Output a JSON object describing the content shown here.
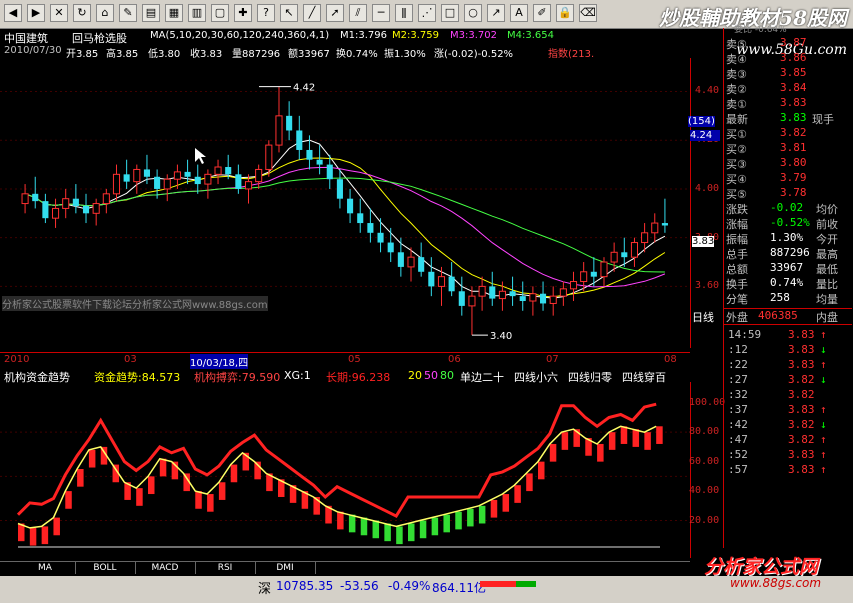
{
  "toolbar": {
    "brand": "炒股輔助教材58股网",
    "icons": [
      "back-icon",
      "forward-icon",
      "stop-icon",
      "refresh-icon",
      "home-icon",
      "edit-icon",
      "book-icon",
      "grid-icon",
      "layout-icon",
      "window-icon",
      "chart-icon",
      "help-icon",
      "cursor-icon",
      "line-icon",
      "ray-icon",
      "channel-icon",
      "hline-icon",
      "fib-icon",
      "gann-icon",
      "rect-icon",
      "ellipse-icon",
      "arrow-icon",
      "text-icon",
      "pen-icon",
      "lock-icon",
      "delete-icon"
    ]
  },
  "watermark_url": "www.58Gu.com",
  "header": {
    "stock_name": "中国建筑",
    "formula": "回马枪选股",
    "ma_label": "MA(5,10,20,30,60,120,240,360,4,1)",
    "m1": "M1:3.796",
    "m2": "M2:3.759",
    "m3": "M3:3.702",
    "m4": "M4:3.654"
  },
  "info_line": {
    "date": "2010/07/30",
    "open": "开3.85",
    "high": "高3.85",
    "low": "低3.80",
    "close": "收3.83",
    "volume": "量887296",
    "amount": "额33967",
    "turnover": "换0.74%",
    "amplitude": "振1.30%",
    "change": "涨(-0.02)-0.52%",
    "index": "指数(213."
  },
  "overlay_text": "分析家公式股票软件下载论坛分析家公式网www.88gs.com",
  "price_axis": [
    "4.40",
    "4.20",
    "4.00",
    "3.80",
    "3.60"
  ],
  "price_highlights": {
    "zoom": "(154)",
    "cursor_price": "4.24",
    "last_price": "3.83"
  },
  "annotations": {
    "high_mark": "4.42",
    "low_mark": "3.40"
  },
  "time_axis": [
    "2010",
    "03",
    "10/03/18,四",
    "05",
    "06",
    "07",
    "08"
  ],
  "indicator": {
    "title": "机构资金趋势",
    "funds_trend": "资金趋势:84.573",
    "inst_move": "机构搏弈:79.590",
    "xg": "XG:1",
    "long_term": "长期:96.238",
    "levels": [
      "20",
      "50",
      "80"
    ],
    "labels": [
      "单边二十",
      "四线小六",
      "四线归零",
      "四线穿百"
    ],
    "axis": [
      "100.00",
      "80.00",
      "60.00",
      "40.00",
      "20.00"
    ]
  },
  "bottom_tabs": [
    "MA",
    "BOLL",
    "MACD",
    "RSI",
    "DMI"
  ],
  "status_bar": {
    "index_name": "深",
    "value": "10785.35",
    "change": "-53.56",
    "pct": "-0.49%",
    "amount": "864.11亿"
  },
  "logo": {
    "text": "分析家公式网",
    "url": "www.88gs.com"
  },
  "quote": {
    "top_clip": "委比 -0.64%",
    "asks": [
      {
        "label": "卖⑤",
        "price": "3.87"
      },
      {
        "label": "卖④",
        "price": "3.86"
      },
      {
        "label": "卖③",
        "price": "3.85"
      },
      {
        "label": "卖②",
        "price": "3.84"
      },
      {
        "label": "卖①",
        "price": "3.83"
      }
    ],
    "latest": {
      "label": "最新",
      "price": "3.83",
      "extra": "现手"
    },
    "bids": [
      {
        "label": "买①",
        "price": "3.82"
      },
      {
        "label": "买②",
        "price": "3.81"
      },
      {
        "label": "买③",
        "price": "3.80"
      },
      {
        "label": "买④",
        "price": "3.79"
      },
      {
        "label": "买⑤",
        "price": "3.78"
      }
    ],
    "stats": [
      {
        "l1": "涨跌",
        "v": "-0.02",
        "l2": "均价"
      },
      {
        "l1": "涨幅",
        "v": "-0.52%",
        "l2": "前收"
      },
      {
        "l1": "振幅",
        "v": "1.30%",
        "l2": "今开"
      },
      {
        "l1": "总手",
        "v": "887296",
        "l2": "最高"
      },
      {
        "l1": "总额",
        "v": "33967",
        "l2": "最低"
      },
      {
        "l1": "换手",
        "v": "0.74%",
        "l2": "量比"
      },
      {
        "l1": "分笔",
        "v": "258",
        "l2": "均量"
      }
    ],
    "tabs": {
      "daily": "日线",
      "outer": "外盘",
      "outer_val": "406385",
      "inner": "内盘"
    },
    "trades": [
      {
        "t": "14:59",
        "p": "3.83",
        "d": "↑"
      },
      {
        "t": ":12",
        "p": "3.83",
        "d": "↓"
      },
      {
        "t": ":22",
        "p": "3.83",
        "d": "↑"
      },
      {
        "t": ":27",
        "p": "3.82",
        "d": "↓"
      },
      {
        "t": ":32",
        "p": "3.82",
        "d": ""
      },
      {
        "t": ":37",
        "p": "3.83",
        "d": "↑"
      },
      {
        "t": ":42",
        "p": "3.82",
        "d": "↓"
      },
      {
        "t": ":47",
        "p": "3.82",
        "d": "↑"
      },
      {
        "t": ":52",
        "p": "3.83",
        "d": "↑"
      },
      {
        "t": ":57",
        "p": "3.83",
        "d": "↑"
      }
    ]
  },
  "chart_data": {
    "type": "candlestick",
    "period": "daily",
    "x_range": [
      "2010-01",
      "2010-08"
    ],
    "ylim": [
      3.38,
      4.48
    ],
    "ohlc": [
      [
        3.94,
        4.02,
        3.9,
        3.98
      ],
      [
        3.98,
        4.05,
        3.92,
        3.95
      ],
      [
        3.95,
        3.98,
        3.86,
        3.88
      ],
      [
        3.88,
        3.96,
        3.84,
        3.92
      ],
      [
        3.92,
        4.0,
        3.88,
        3.96
      ],
      [
        3.96,
        4.02,
        3.9,
        3.93
      ],
      [
        3.93,
        3.98,
        3.86,
        3.9
      ],
      [
        3.9,
        3.96,
        3.85,
        3.94
      ],
      [
        3.94,
        4.0,
        3.9,
        3.98
      ],
      [
        3.98,
        4.1,
        3.95,
        4.06
      ],
      [
        4.06,
        4.12,
        4.0,
        4.03
      ],
      [
        4.03,
        4.1,
        3.98,
        4.08
      ],
      [
        4.08,
        4.14,
        4.02,
        4.05
      ],
      [
        4.05,
        4.08,
        3.96,
        4.0
      ],
      [
        4.0,
        4.06,
        3.95,
        4.04
      ],
      [
        4.04,
        4.1,
        4.0,
        4.07
      ],
      [
        4.07,
        4.12,
        4.02,
        4.05
      ],
      [
        4.05,
        4.1,
        3.98,
        4.02
      ],
      [
        4.02,
        4.08,
        3.96,
        4.06
      ],
      [
        4.06,
        4.12,
        4.02,
        4.09
      ],
      [
        4.09,
        4.14,
        4.04,
        4.06
      ],
      [
        4.06,
        4.1,
        3.98,
        4.0
      ],
      [
        4.0,
        4.06,
        3.94,
        4.03
      ],
      [
        4.03,
        4.1,
        4.0,
        4.08
      ],
      [
        4.08,
        4.2,
        4.05,
        4.18
      ],
      [
        4.18,
        4.42,
        4.15,
        4.3
      ],
      [
        4.3,
        4.36,
        4.2,
        4.24
      ],
      [
        4.24,
        4.3,
        4.12,
        4.16
      ],
      [
        4.16,
        4.22,
        4.08,
        4.12
      ],
      [
        4.12,
        4.18,
        4.06,
        4.1
      ],
      [
        4.1,
        4.14,
        4.0,
        4.04
      ],
      [
        4.04,
        4.08,
        3.92,
        3.96
      ],
      [
        3.96,
        4.0,
        3.86,
        3.9
      ],
      [
        3.9,
        3.96,
        3.82,
        3.86
      ],
      [
        3.86,
        3.92,
        3.78,
        3.82
      ],
      [
        3.82,
        3.88,
        3.74,
        3.78
      ],
      [
        3.78,
        3.84,
        3.7,
        3.74
      ],
      [
        3.74,
        3.8,
        3.64,
        3.68
      ],
      [
        3.68,
        3.76,
        3.62,
        3.72
      ],
      [
        3.72,
        3.78,
        3.64,
        3.66
      ],
      [
        3.66,
        3.72,
        3.56,
        3.6
      ],
      [
        3.6,
        3.68,
        3.52,
        3.64
      ],
      [
        3.64,
        3.7,
        3.56,
        3.58
      ],
      [
        3.58,
        3.64,
        3.48,
        3.52
      ],
      [
        3.52,
        3.6,
        3.4,
        3.56
      ],
      [
        3.56,
        3.64,
        3.5,
        3.6
      ],
      [
        3.6,
        3.66,
        3.52,
        3.55
      ],
      [
        3.55,
        3.62,
        3.5,
        3.58
      ],
      [
        3.58,
        3.64,
        3.52,
        3.56
      ],
      [
        3.56,
        3.62,
        3.5,
        3.54
      ],
      [
        3.54,
        3.6,
        3.48,
        3.57
      ],
      [
        3.57,
        3.62,
        3.5,
        3.53
      ],
      [
        3.53,
        3.6,
        3.48,
        3.56
      ],
      [
        3.56,
        3.62,
        3.52,
        3.59
      ],
      [
        3.59,
        3.66,
        3.54,
        3.62
      ],
      [
        3.62,
        3.7,
        3.58,
        3.66
      ],
      [
        3.66,
        3.72,
        3.6,
        3.64
      ],
      [
        3.64,
        3.72,
        3.6,
        3.7
      ],
      [
        3.7,
        3.78,
        3.66,
        3.74
      ],
      [
        3.74,
        3.8,
        3.68,
        3.72
      ],
      [
        3.72,
        3.8,
        3.68,
        3.78
      ],
      [
        3.78,
        3.86,
        3.74,
        3.82
      ],
      [
        3.82,
        3.9,
        3.78,
        3.86
      ],
      [
        3.86,
        3.96,
        3.82,
        3.85
      ]
    ],
    "indicator_series": {
      "funds_trend": [
        18,
        15,
        16,
        22,
        40,
        55,
        68,
        70,
        58,
        46,
        42,
        50,
        62,
        60,
        52,
        40,
        38,
        46,
        58,
        66,
        60,
        52,
        48,
        44,
        40,
        36,
        30,
        26,
        24,
        22,
        20,
        18,
        16,
        18,
        20,
        22,
        24,
        26,
        28,
        30,
        34,
        38,
        44,
        52,
        60,
        72,
        80,
        82,
        76,
        72,
        80,
        84,
        82,
        80,
        84
      ]
    },
    "axis_labels": [
      "2010",
      "03",
      "10/03/18,四",
      "05",
      "06",
      "07",
      "08"
    ]
  }
}
